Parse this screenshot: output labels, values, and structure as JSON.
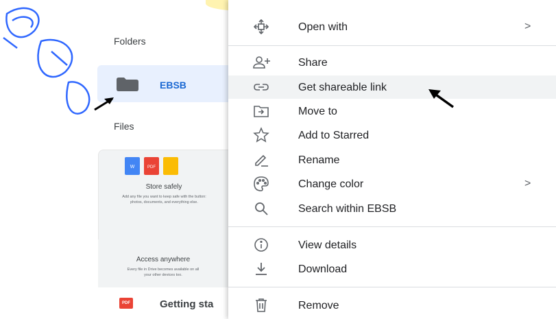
{
  "left_panel": {
    "folders_heading": "Folders",
    "folder": {
      "name": "EBSB"
    },
    "files_heading": "Files",
    "card": {
      "title": "Store safely",
      "description": "Add any file you want to keep safe with the button: photos, documents, and everything else.",
      "doc_labels": [
        "W",
        "PDF",
        ""
      ],
      "title2": "Access anywhere",
      "description2": "Every file in Drive becomes available on all your other devices too."
    },
    "file_row": {
      "name": "Getting sta",
      "badge": "PDF"
    }
  },
  "context_menu": {
    "items": [
      {
        "label": "Open with",
        "icon": "open-with-icon",
        "submenu": ">"
      },
      {
        "label": "Share",
        "icon": "add-person-icon"
      },
      {
        "label": "Get shareable link",
        "icon": "link-icon",
        "highlighted": true
      },
      {
        "label": "Move to",
        "icon": "move-to-folder-icon"
      },
      {
        "label": "Add to Starred",
        "icon": "star-icon"
      },
      {
        "label": "Rename",
        "icon": "pencil-icon"
      },
      {
        "label": "Change color",
        "icon": "palette-icon",
        "submenu": ">"
      },
      {
        "label": "Search within EBSB",
        "icon": "search-icon"
      },
      {
        "label": "View details",
        "icon": "info-icon"
      },
      {
        "label": "Download",
        "icon": "download-icon"
      },
      {
        "label": "Remove",
        "icon": "trash-icon"
      }
    ]
  },
  "colors": {
    "folder_selected_bg": "#e8f0fe",
    "folder_text": "#1967d2",
    "menu_highlight": "#f1f3f4",
    "watermark_yellow": "#ffe066",
    "watermark_green": "#b7f5c8",
    "watermark_blue": "#1a5cff"
  }
}
